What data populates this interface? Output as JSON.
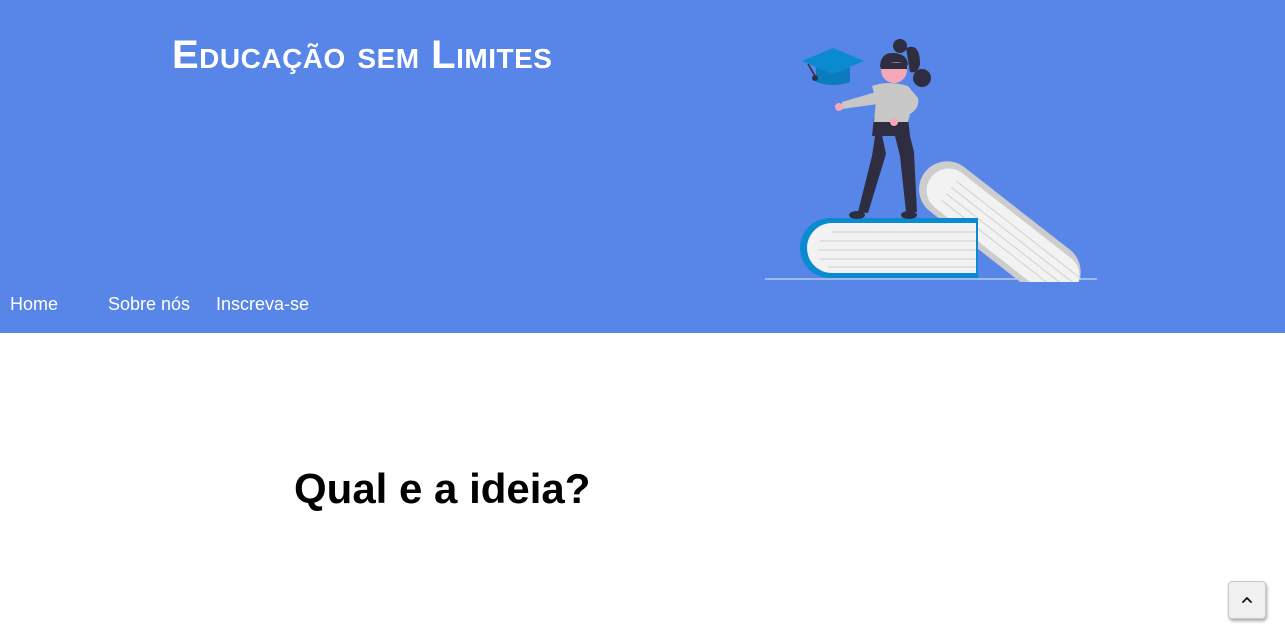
{
  "header": {
    "title": "Educação sem Limites",
    "background_color": "#5785e8",
    "illustration": "woman-standing-on-books-with-graduation-cap"
  },
  "nav": {
    "items": [
      {
        "label": "Home"
      },
      {
        "label": "Sobre nós"
      },
      {
        "label": "Inscreva-se"
      }
    ]
  },
  "main": {
    "heading": "Qual e a ideia?"
  },
  "scroll_top": {
    "icon": "chevron-up-icon"
  },
  "colors": {
    "accent_blue": "#5785e8",
    "book_blue": "#0a8ad1"
  }
}
